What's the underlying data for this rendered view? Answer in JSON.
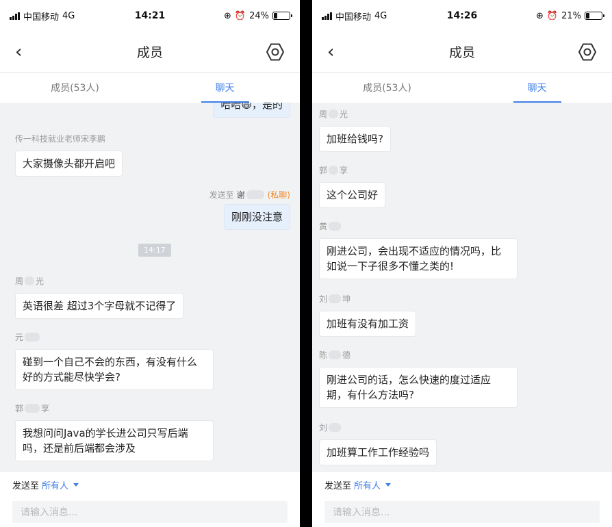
{
  "left": {
    "status": {
      "carrier": "中国移动",
      "network": "4G",
      "time": "14:21",
      "battery_text": "24%",
      "battery_level": 0.24
    },
    "nav": {
      "title": "成员"
    },
    "tabs": [
      {
        "label": "成员(53人)"
      },
      {
        "label": "聊天"
      }
    ],
    "partial_msg": {
      "text": "哈哈😄，是的"
    },
    "messages": [
      {
        "sender": "传一科技就业老师宋李鹏",
        "text": "大家摄像头都开启吧"
      },
      {
        "sender_a": "周",
        "sender_b": "光",
        "text": "英语很差  超过3个字母就不记得了"
      },
      {
        "sender_a": "元",
        "sender_b": "",
        "text": "碰到一个自己不会的东西，有没有什么好的方式能尽快学会?"
      },
      {
        "sender_a": "郭",
        "sender_b": "享",
        "text": "我想问问Java的学长进公司只写后端吗，还是前后端都会涉及"
      }
    ],
    "private": {
      "prefix": "发送至",
      "name_a": "谢",
      "name_b": "",
      "tag": "(私聊)",
      "text": "刚刚没注意"
    },
    "timestamp": "14:17",
    "footer": {
      "send_to": "发送至",
      "audience": "所有人",
      "placeholder": "请输入消息..."
    }
  },
  "right": {
    "status": {
      "carrier": "中国移动",
      "network": "4G",
      "time": "14:26",
      "battery_text": "21%",
      "battery_level": 0.21
    },
    "nav": {
      "title": "成员"
    },
    "tabs": [
      {
        "label": "成员(53人)"
      },
      {
        "label": "聊天"
      }
    ],
    "messages": [
      {
        "sender_a": "周",
        "sender_b": "光",
        "text": "加班给钱吗?"
      },
      {
        "sender_a": "郭",
        "sender_b": "享",
        "text": "这个公司好"
      },
      {
        "sender_a": "黄",
        "sender_b": "",
        "text": "刚进公司，会出现不适应的情况吗，比如说一下子很多不懂之类的!"
      },
      {
        "sender_a": "刘",
        "sender_b": "坤",
        "text": "加班有没有加工资"
      },
      {
        "sender_a": "陈",
        "sender_b": "德",
        "text": "刚进公司的话，怎么快速的度过适应期，有什么方法吗?"
      },
      {
        "sender_a": "刘",
        "sender_b": "",
        "text": "加班算工作工作经验吗"
      }
    ],
    "footer": {
      "send_to": "发送至",
      "audience": "所有人",
      "placeholder": "请输入消息..."
    }
  }
}
